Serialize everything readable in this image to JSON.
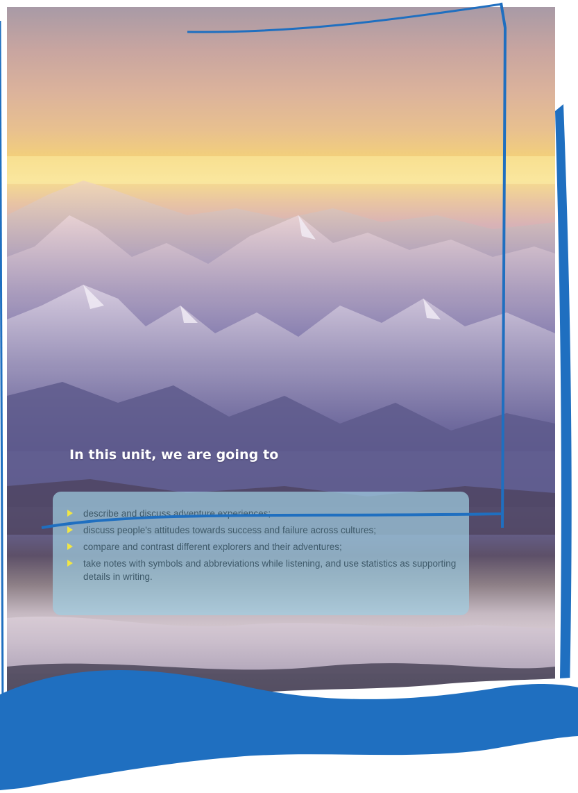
{
  "heading": "In this unit, we are going to",
  "goals": [
    "describe and discuss adventure experiences;",
    "discuss people's attitudes towards success and failure across cultures;",
    "compare and contrast different explorers and their adventures;",
    "take notes with symbols and abbreviations while listening, and use statistics as supporting details in writing."
  ],
  "colors": {
    "frame_blue": "#1f6fc0",
    "goals_box": "#a0cde1",
    "bullet": "#f1e645",
    "heading_text": "#ffffff"
  },
  "icons": {
    "bullet": "triangle-bullet-icon"
  }
}
